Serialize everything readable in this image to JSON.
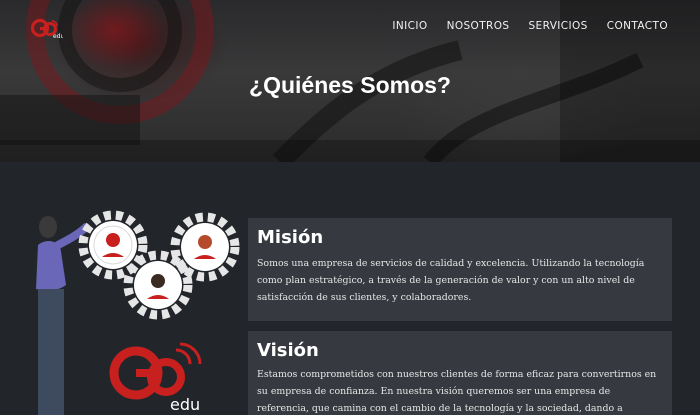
{
  "header": {
    "logo_text": "GO edu",
    "nav": [
      "INICIO",
      "NOSOTROS",
      "SERVICIOS",
      "CONTACTO"
    ],
    "title": "¿Quiénes Somos?"
  },
  "illustration": {
    "logo_text": "GO edu",
    "icon": "team-gears-illustration"
  },
  "mision": {
    "heading": "Misión",
    "text": "Somos una empresa de servicios de calidad y excelencia. Utilizando la tecnología como plan estratégico, a través de la generación de valor y con un alto nivel de satisfacción de sus clientes, y colaboradores."
  },
  "vision": {
    "heading": "Visión",
    "text": "Estamos comprometidos con nuestros clientes de forma eficaz para convertirnos en su empresa de confianza. En nuestra visión queremos ser una empresa de referencia, que camina con el cambio de la tecnología y la sociedad, dando a conocer las posibilidades de los"
  },
  "colors": {
    "brand_red": "#c8201f",
    "background": "#22262b",
    "card": "#363a40"
  }
}
